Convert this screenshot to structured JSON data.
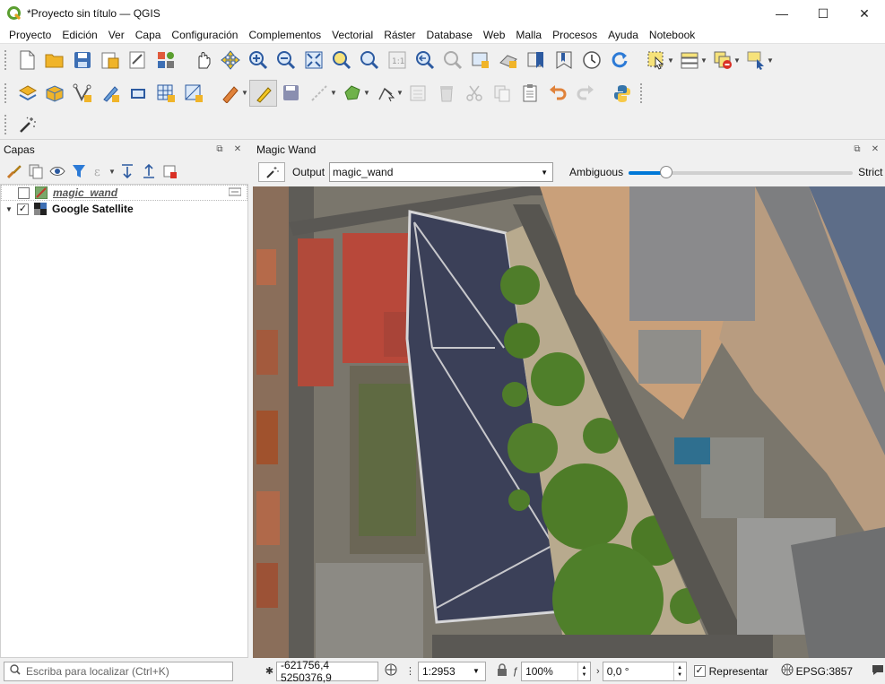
{
  "window": {
    "title": "*Proyecto sin título — QGIS"
  },
  "menu": [
    "Proyecto",
    "Edición",
    "Ver",
    "Capa",
    "Configuración",
    "Complementos",
    "Vectorial",
    "Ráster",
    "Database",
    "Web",
    "Malla",
    "Procesos",
    "Ayuda",
    "Notebook"
  ],
  "layers_panel": {
    "title": "Capas",
    "layers": [
      {
        "name": "magic_wand",
        "checked": false,
        "italic": true
      },
      {
        "name": "Google Satellite",
        "checked": true,
        "bold": true
      }
    ]
  },
  "magic_wand_panel": {
    "title": "Magic Wand",
    "output_label": "Output",
    "output_value": "magic_wand",
    "ambiguous_label": "Ambiguous",
    "strict_label": "Strict",
    "tolerance_fraction": 0.15
  },
  "status": {
    "locator_placeholder": "Escriba para localizar (Ctrl+K)",
    "coordinate": "-621756,4  5250376,9",
    "scale": "1:2953",
    "magnifier": "100%",
    "rotation": "0,0 °",
    "render_label": "Representar",
    "crs": "EPSG:3857"
  },
  "colors": {
    "accent": "#0078d7",
    "qgis_green": "#5a9e2f"
  }
}
